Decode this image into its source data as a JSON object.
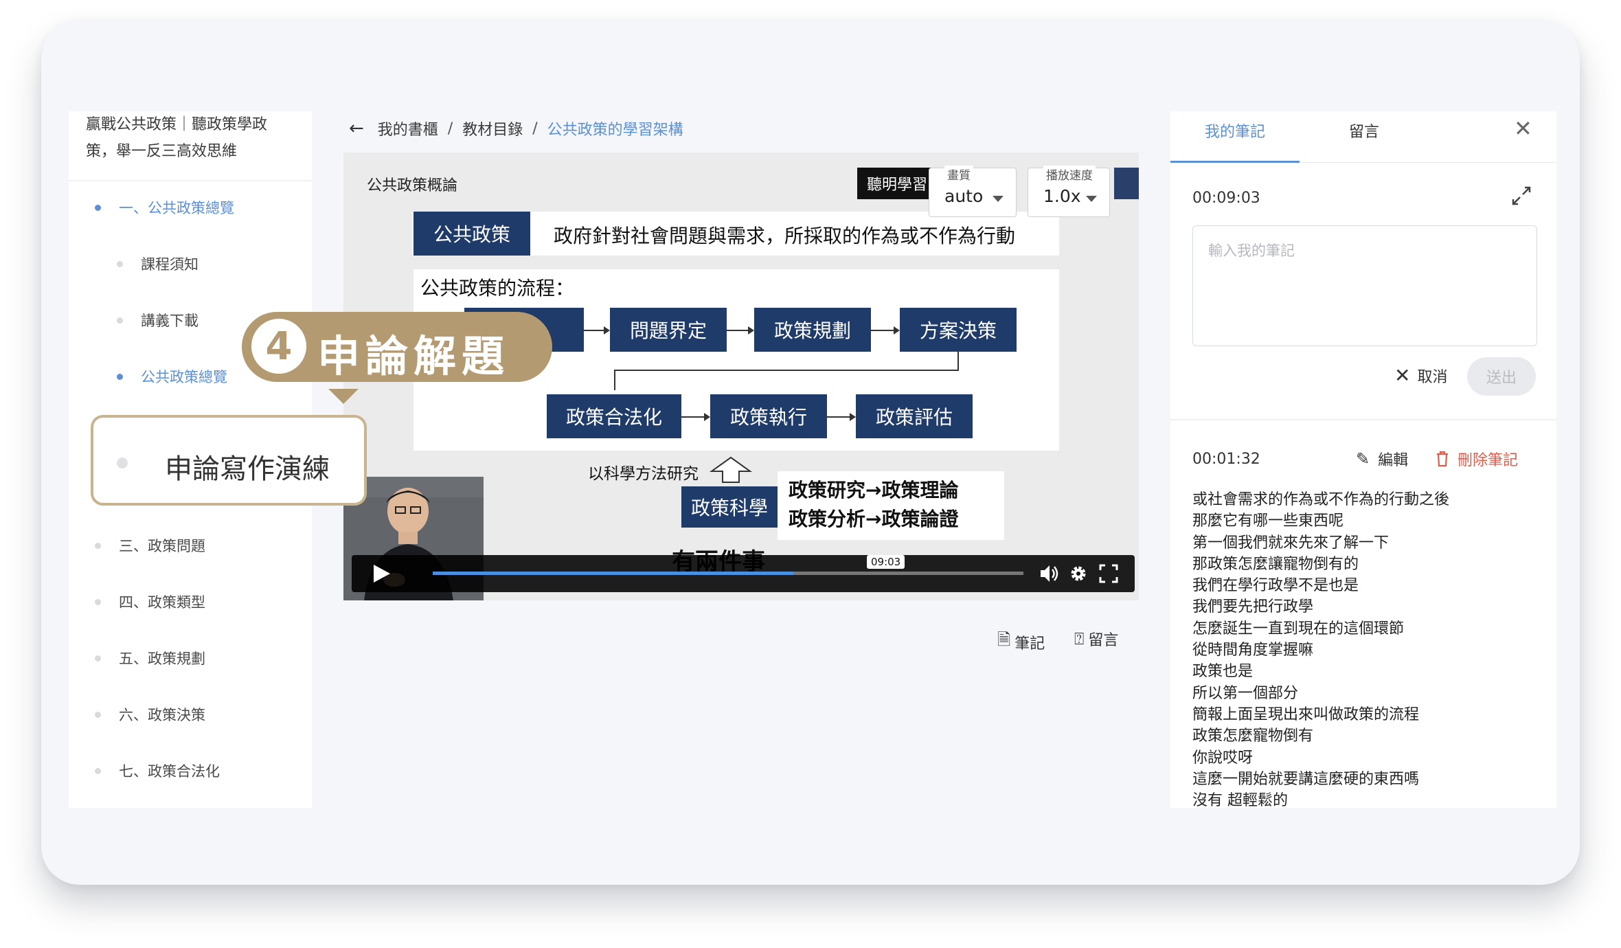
{
  "course": {
    "title": "贏戰公共政策｜聽政策學政策，舉一反三高效思維"
  },
  "nav": {
    "items": [
      {
        "label": "一、公共政策總覽",
        "active": true
      },
      {
        "label": "課程須知"
      },
      {
        "label": "講義下載"
      },
      {
        "label": "公共政策總覽",
        "active": true
      },
      {
        "label": "三、政策問題"
      },
      {
        "label": "四、政策類型"
      },
      {
        "label": "五、政策規劃"
      },
      {
        "label": "六、政策決策"
      },
      {
        "label": "七、政策合法化"
      }
    ]
  },
  "breadcrumb": {
    "back": "←",
    "items": [
      "我的書櫃",
      "教材目錄",
      "公共政策的學習架構"
    ],
    "sep": "/"
  },
  "video": {
    "category": "公共政策概論",
    "brand": "聽明學習",
    "quality": {
      "label": "畫質",
      "value": "auto"
    },
    "speed": {
      "label": "播放速度",
      "value": "1.0x"
    },
    "definition_key": "公共政策",
    "definition_text": "政府針對社會問題與需求，所採取的作為或不作為行動",
    "flow_title": "公共政策的流程：",
    "flow_row1": [
      "定",
      "問題界定",
      "政策規劃",
      "方案決策"
    ],
    "flow_row2": [
      "政策合法化",
      "政策執行",
      "政策評估"
    ],
    "science_label": "以科學方法研究",
    "science_box": "政策科學",
    "science_lines": [
      "政策研究→政策理論",
      "政策分析→政策論證"
    ],
    "subtitle": "有兩件事",
    "time_tip": "09:03",
    "progress_fraction": 0.61
  },
  "tools": {
    "note": "筆記",
    "comment": "留言"
  },
  "overlay": {
    "number": "4",
    "title": "申論解題",
    "callout": "申論寫作演練"
  },
  "notes_panel": {
    "tabs": [
      "我的筆記",
      "留言"
    ],
    "close": "✕",
    "current_time": "00:09:03",
    "placeholder": "輸入我的筆記",
    "cancel": "取消",
    "send": "送出",
    "saved": {
      "time": "00:01:32",
      "edit": "編輯",
      "delete": "刪除筆記",
      "lines": [
        "或社會需求的作為或不作為的行動之後",
        "那麼它有哪一些東西呢",
        "第一個我們就來先來了解一下",
        "那政策怎麼讓寵物倒有的",
        "我們在學行政學不是也是",
        "我們要先把行政學",
        "怎麼誕生一直到現在的這個環節",
        "從時間角度掌握嘛",
        "政策也是",
        "所以第一個部分",
        "簡報上面呈現出來叫做政策的流程",
        "政策怎麼寵物倒有",
        "你說哎呀",
        "這麼一開始就要講這麼硬的東西嗎",
        "沒有 超輕鬆的"
      ]
    }
  }
}
